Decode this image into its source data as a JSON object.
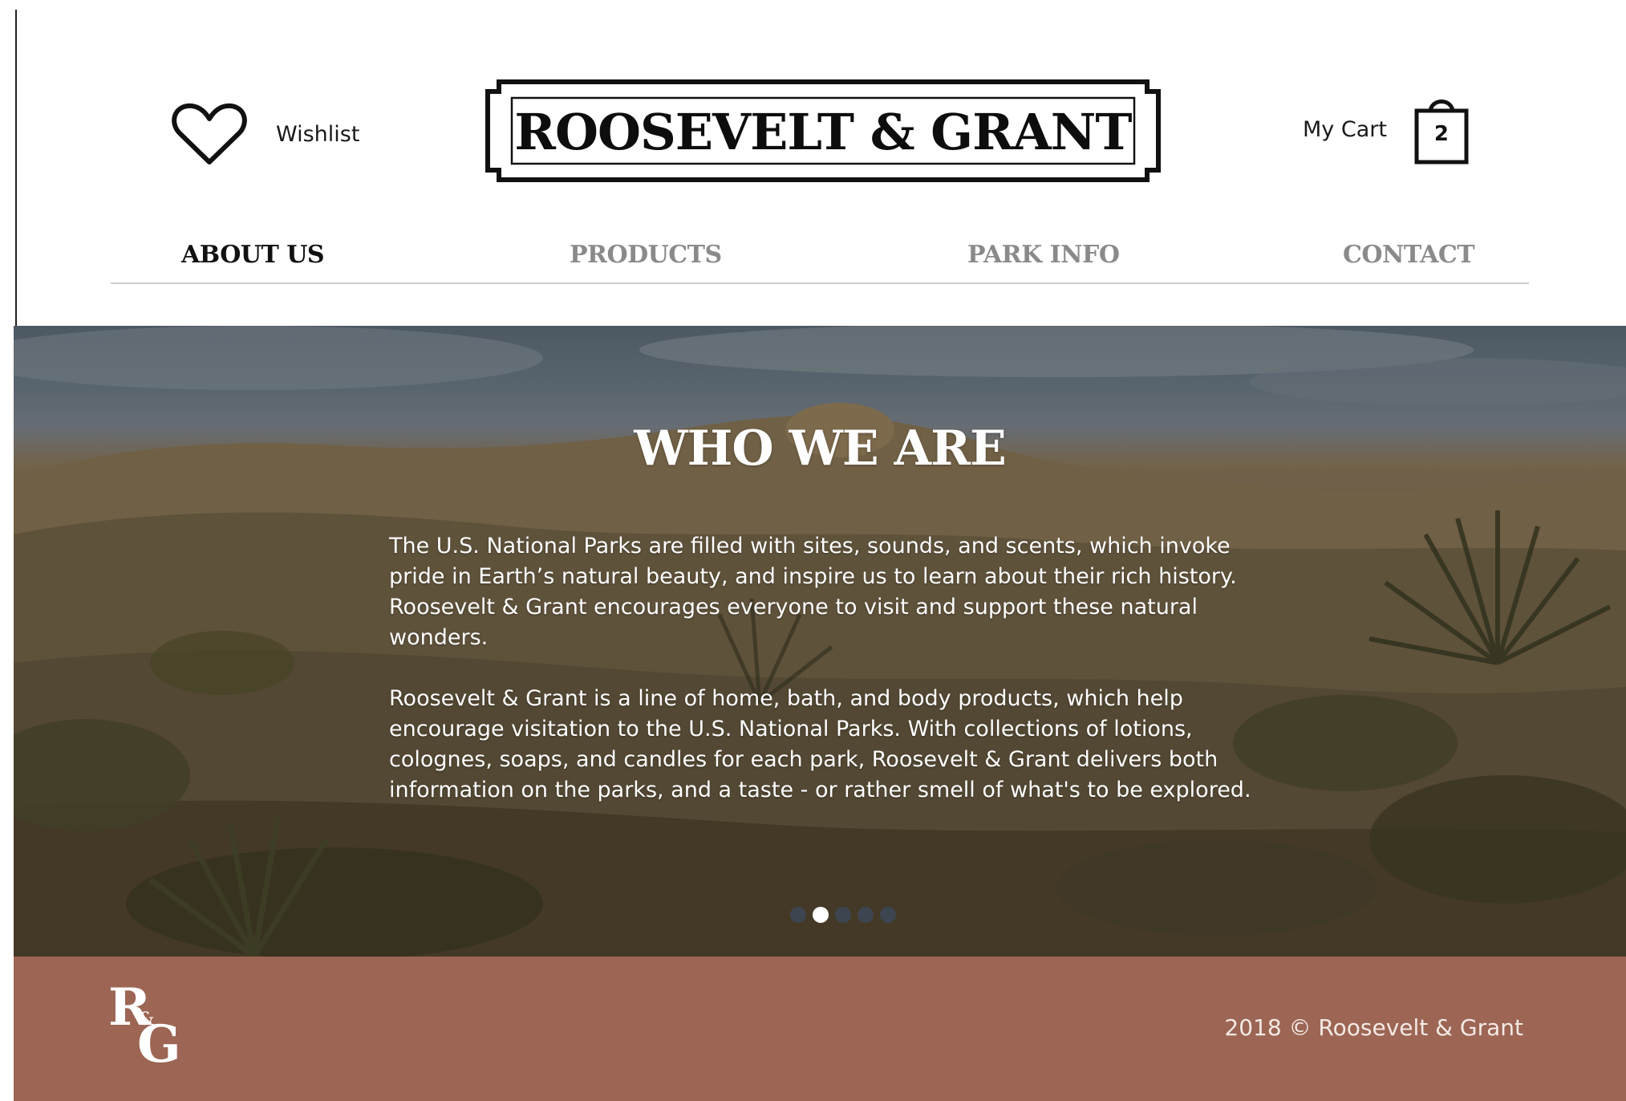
{
  "header": {
    "wishlist_label": "Wishlist",
    "wishlist_icon": "heart-icon",
    "logo_text": "ROOSEVELT & GRANT",
    "cart_label": "My Cart",
    "cart_icon": "shopping-bag-icon",
    "cart_count": "2"
  },
  "nav": {
    "items": [
      {
        "label": "ABOUT US",
        "active": true
      },
      {
        "label": "PRODUCTS",
        "active": false
      },
      {
        "label": "PARK INFO",
        "active": false
      },
      {
        "label": "CONTACT",
        "active": false
      }
    ]
  },
  "hero": {
    "title": "WHO WE ARE",
    "paragraphs": [
      "The U.S. National Parks are filled with sites, sounds, and scents, which invoke pride in Earth’s natural beauty, and inspire us to learn about their rich history. Roosevelt & Grant encourages everyone to visit and support these natural wonders.",
      "Roosevelt & Grant is a line of home, bath, and body products, which help encourage visitation to the U.S. National Parks. With collections of lotions, colognes, soaps, and candles for each park, Roosevelt & Grant delivers both information on the parks, and a taste - or rather smell of what's to be explored."
    ],
    "slides_total": 5,
    "slide_active": 2
  },
  "footer": {
    "logo_r": "R",
    "logo_amp": "&",
    "logo_g": "G",
    "copyright": "2018 © Roosevelt & Grant"
  },
  "colors": {
    "footer_bg": "#9c6554",
    "nav_active": "#111111",
    "nav_inactive": "#8a8a8a"
  }
}
